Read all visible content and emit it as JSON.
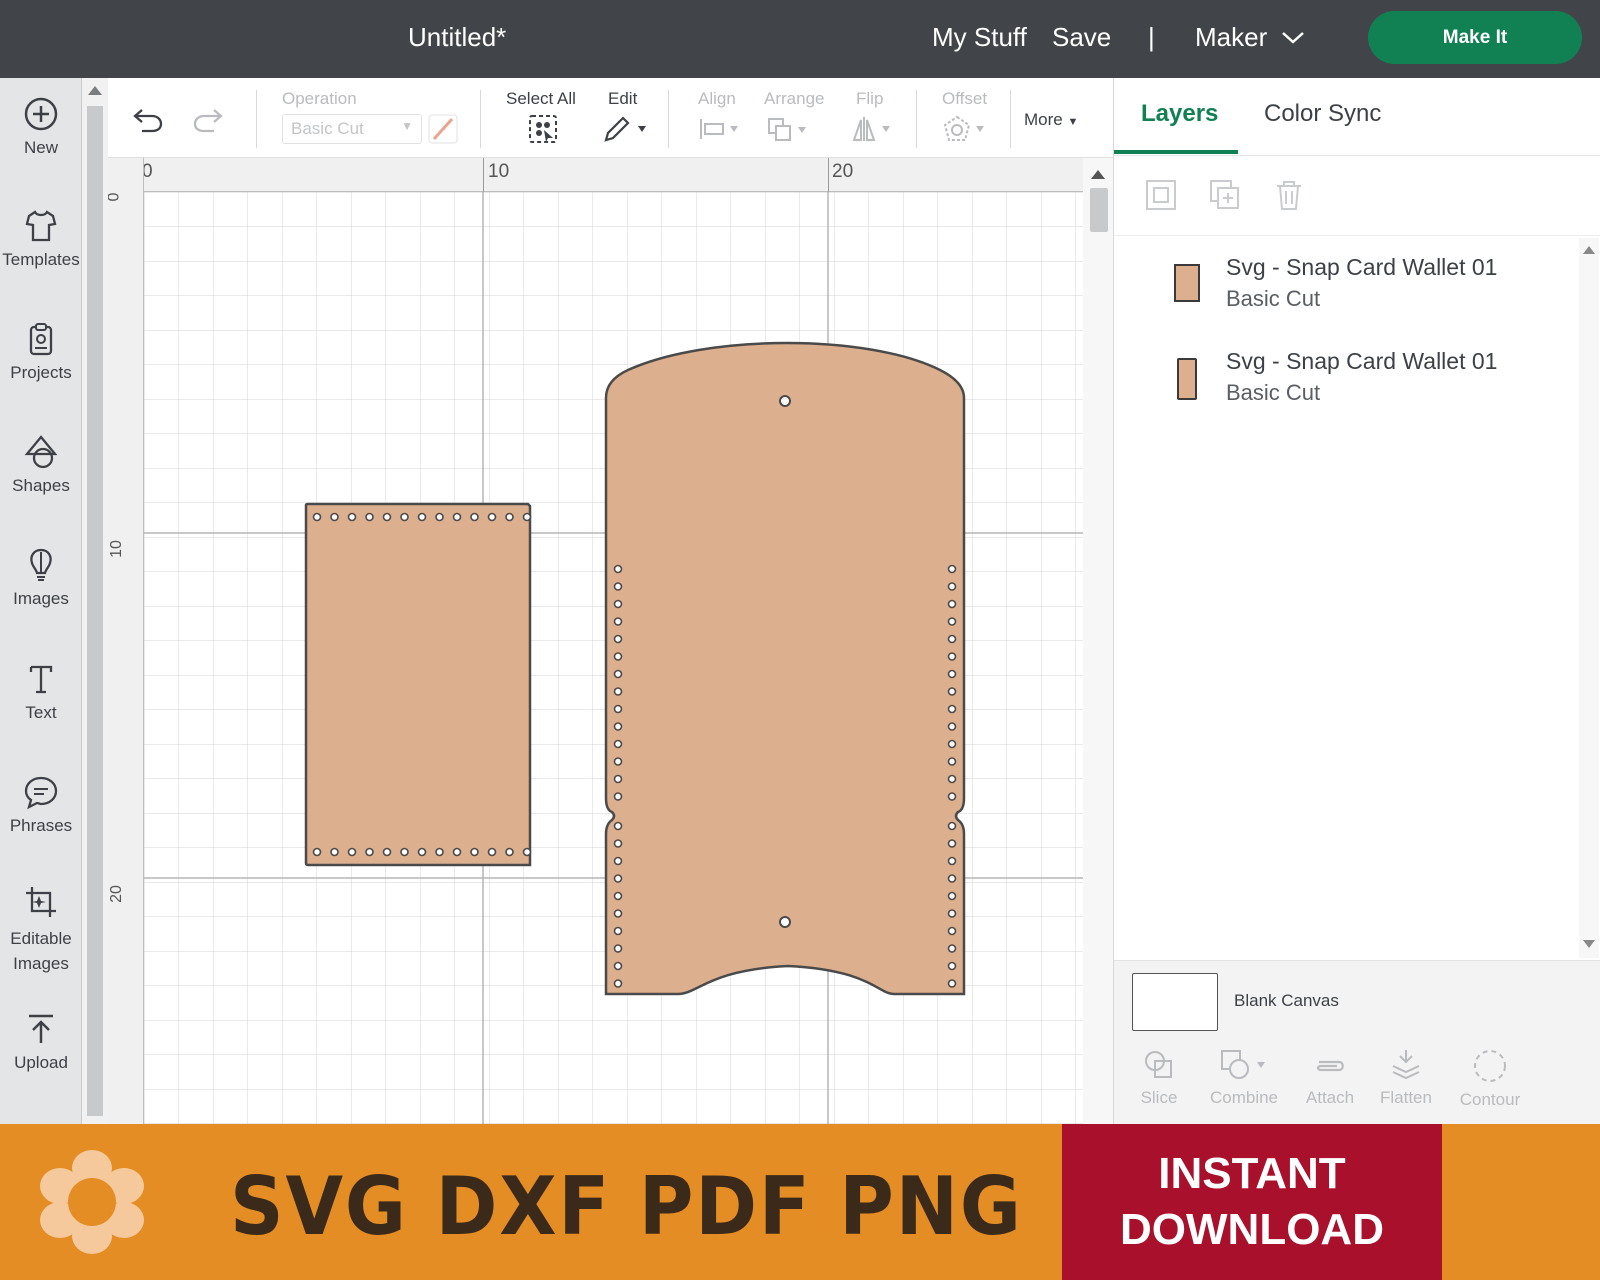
{
  "topbar": {
    "title": "Untitled*",
    "my_stuff": "My Stuff",
    "save": "Save",
    "separator": "|",
    "machine": "Maker",
    "make_it": "Make It"
  },
  "left_nav": [
    {
      "label": "New",
      "icon": "plus-circle-icon"
    },
    {
      "label": "Templates",
      "icon": "tshirt-icon"
    },
    {
      "label": "Projects",
      "icon": "clipboard-icon"
    },
    {
      "label": "Shapes",
      "icon": "shapes-icon"
    },
    {
      "label": "Images",
      "icon": "bulb-icon"
    },
    {
      "label": "Text",
      "icon": "text-icon"
    },
    {
      "label": "Phrases",
      "icon": "speech-bubble-icon"
    },
    {
      "label": "Editable Images",
      "icon": "editable-images-icon"
    },
    {
      "label": "Upload",
      "icon": "upload-icon"
    }
  ],
  "toolbar": {
    "operation_label": "Operation",
    "operation_value": "Basic Cut",
    "select_all": "Select All",
    "edit": "Edit",
    "align": "Align",
    "arrange": "Arrange",
    "flip": "Flip",
    "offset": "Offset",
    "more": "More"
  },
  "rulers": {
    "horizontal": [
      "0",
      "10",
      "20"
    ],
    "vertical": [
      "0",
      "10",
      "20"
    ]
  },
  "canvas": {
    "shape_fill": "#dcaf8e",
    "shape_stroke": "#4a4a4a"
  },
  "right_panel": {
    "tabs": [
      "Layers",
      "Color Sync"
    ],
    "layers": [
      {
        "name": "Svg - Snap Card Wallet 01",
        "operation": "Basic Cut"
      },
      {
        "name": "Svg - Snap Card Wallet 01",
        "operation": "Basic Cut"
      }
    ],
    "blank_canvas": "Blank Canvas",
    "bottom_tools": [
      "Slice",
      "Combine",
      "Attach",
      "Flatten",
      "Contour"
    ]
  },
  "banner": {
    "formats": "SVG DXF PDF PNG",
    "download_line1": "INSTANT",
    "download_line2": "DOWNLOAD",
    "bg_color": "#e38d24",
    "download_bg": "#a8102c"
  }
}
